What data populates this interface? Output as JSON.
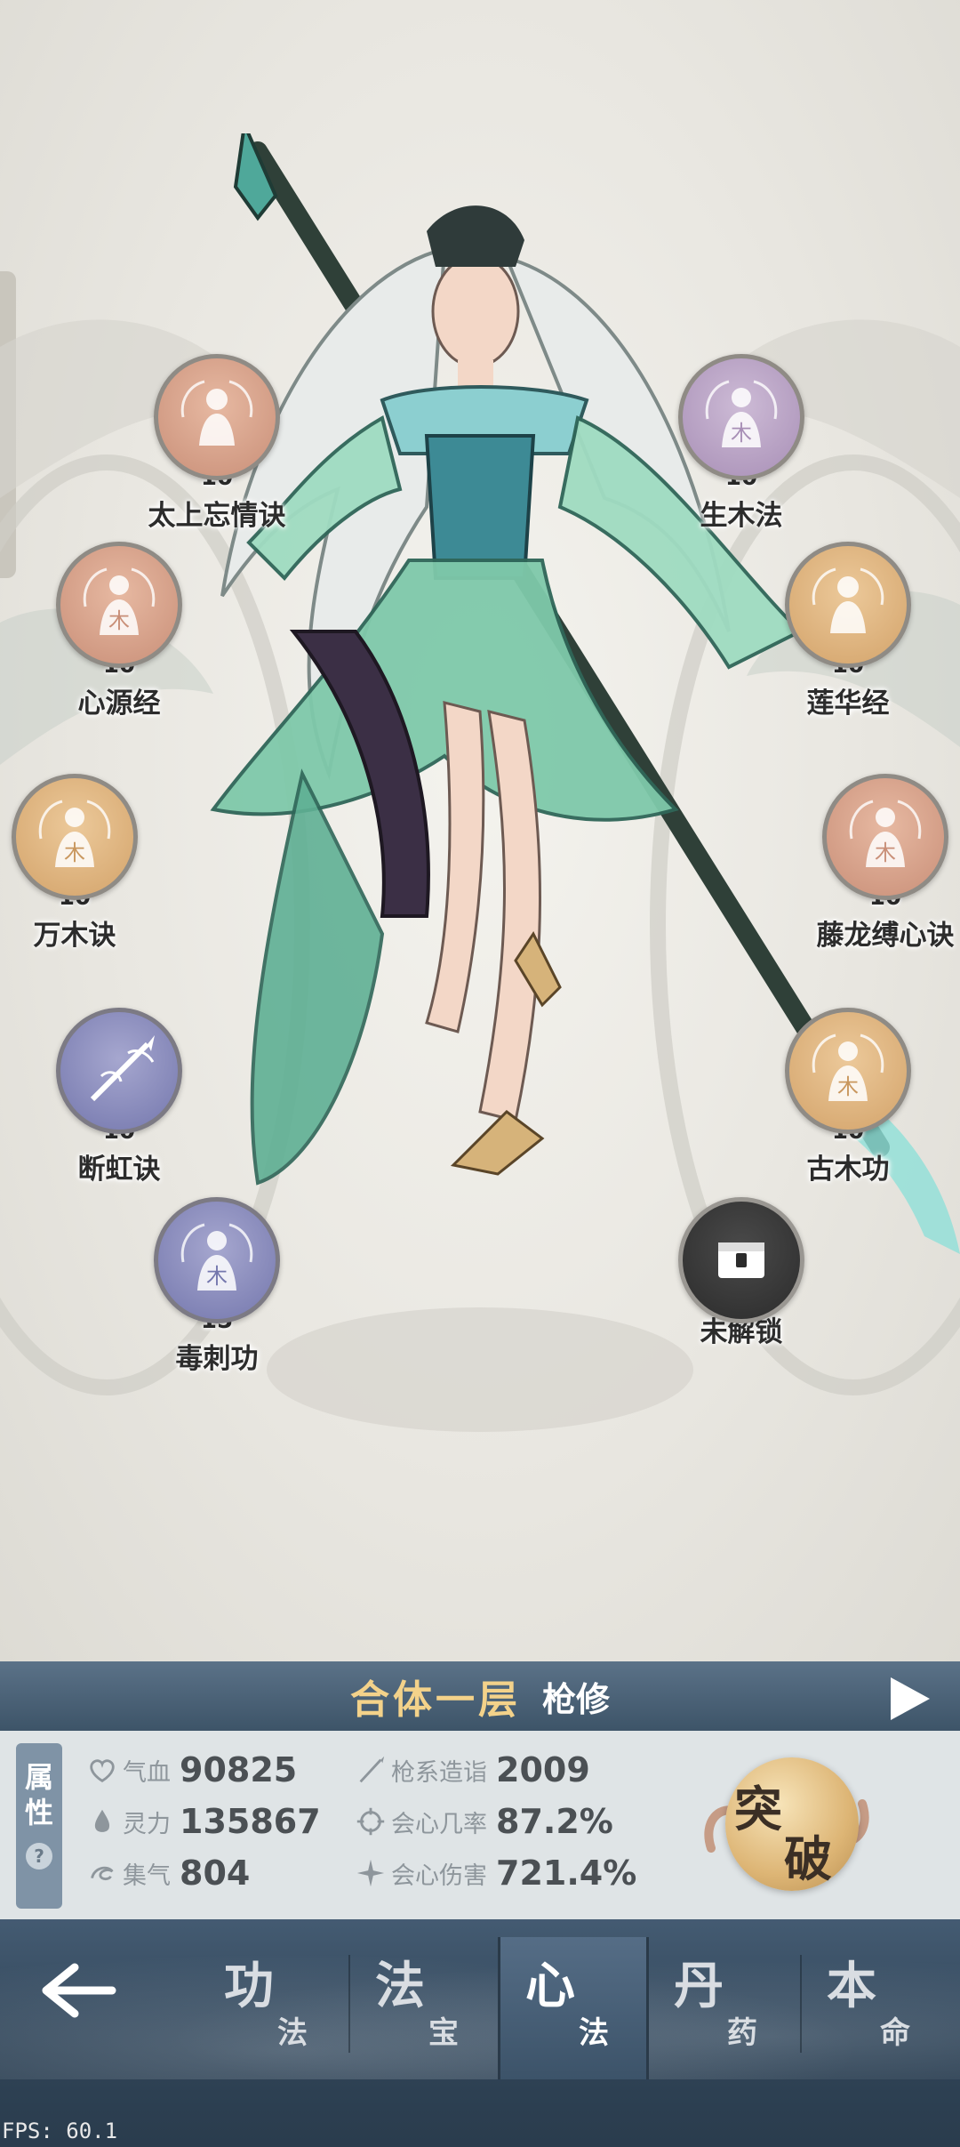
{
  "skills_left": [
    {
      "name": "太上忘情诀",
      "level": "10",
      "style": "orange",
      "icon": "figure-icon"
    },
    {
      "name": "心源经",
      "level": "10",
      "style": "orange",
      "icon": "figure-wood-icon"
    },
    {
      "name": "万木诀",
      "level": "10",
      "style": "amber",
      "icon": "figure-wood-icon"
    },
    {
      "name": "断虹诀",
      "level": "10",
      "style": "blue",
      "icon": "spear-icon"
    },
    {
      "name": "毒刺功",
      "level": "15",
      "style": "blue",
      "icon": "figure-wood-icon"
    }
  ],
  "skills_right": [
    {
      "name": "生木法",
      "level": "10",
      "style": "purple",
      "icon": "figure-wood-icon"
    },
    {
      "name": "莲华经",
      "level": "10",
      "style": "amber",
      "icon": "figure-icon"
    },
    {
      "name": "藤龙缚心诀",
      "level": "10",
      "style": "orange",
      "icon": "figure-wood-icon"
    },
    {
      "name": "古木功",
      "level": "10",
      "style": "amber",
      "icon": "figure-wood-icon"
    },
    {
      "name": "未解锁",
      "level": "",
      "style": "locked",
      "icon": "lock-chest-icon"
    }
  ],
  "realm": {
    "title": "合体一层",
    "type": "枪修"
  },
  "attributes": {
    "tab_label_1": "属",
    "tab_label_2": "性",
    "help": "?",
    "stats": [
      {
        "label": "气血",
        "value": "90825",
        "icon": "heart-icon"
      },
      {
        "label": "灵力",
        "value": "135867",
        "icon": "spirit-drop-icon"
      },
      {
        "label": "集气",
        "value": "804",
        "icon": "swirl-icon"
      },
      {
        "label": "枪系造诣",
        "value": "2009",
        "icon": "spear-icon"
      },
      {
        "label": "会心几率",
        "value": "87.2%",
        "icon": "crit-rate-icon"
      },
      {
        "label": "会心伤害",
        "value": "721.4%",
        "icon": "crit-damage-icon"
      }
    ]
  },
  "breakthrough": {
    "char1": "突",
    "char2": "破"
  },
  "nav": [
    {
      "big": "功",
      "small": "法"
    },
    {
      "big": "法",
      "small": "宝"
    },
    {
      "big": "心",
      "small": "法"
    },
    {
      "big": "丹",
      "small": "药"
    },
    {
      "big": "本",
      "small": "命"
    }
  ],
  "fps": "FPS: 60.1"
}
